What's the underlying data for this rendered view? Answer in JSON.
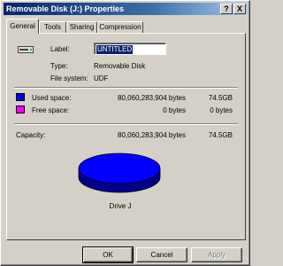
{
  "window": {
    "title": "Removable Disk (J:) Properties",
    "help_glyph": "?",
    "close_glyph": "X"
  },
  "tabs": [
    {
      "label": "General",
      "active": true
    },
    {
      "label": "Tools",
      "active": false
    },
    {
      "label": "Sharing",
      "active": false
    },
    {
      "label": "Compression",
      "active": false
    }
  ],
  "general": {
    "label_caption": "Label:",
    "label_value": "UNTITLED",
    "type_caption": "Type:",
    "type_value": "Removable Disk",
    "fs_caption": "File system:",
    "fs_value": "UDF"
  },
  "space": {
    "used": {
      "caption": "Used space:",
      "bytes": "80,060,283,904 bytes",
      "size": "74.5GB",
      "color": "#0000ff"
    },
    "free": {
      "caption": "Free space:",
      "bytes": "0 bytes",
      "size": "0 bytes",
      "color": "#ff00ff"
    },
    "capacity": {
      "caption": "Capacity:",
      "bytes": "80,060,283,904 bytes",
      "size": "74.5GB"
    }
  },
  "chart_data": {
    "type": "pie",
    "categories": [
      "Used space",
      "Free space"
    ],
    "values": [
      80060283904,
      0
    ],
    "colors": [
      "#0000ff",
      "#ff00ff"
    ],
    "label": "Drive J"
  },
  "buttons": {
    "ok": "OK",
    "cancel": "Cancel",
    "apply": "Apply"
  },
  "icons": {
    "drive": "removable-drive-icon"
  }
}
